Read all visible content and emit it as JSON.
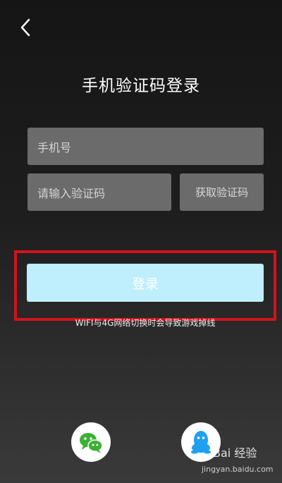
{
  "header": {
    "back_icon": "chevron-left-icon",
    "title": "手机验证码登录"
  },
  "form": {
    "phone_placeholder": "手机号",
    "code_placeholder": "请输入验证码",
    "get_code_label": "获取验证码",
    "login_label": "登录",
    "notice": "WIFI与4G网络切换时会导致游戏掉线"
  },
  "social": {
    "wechat_icon": "wechat-icon",
    "qq_icon": "qq-icon"
  },
  "watermark": {
    "logo": "Bai 经验",
    "url": "jingyan.baidu.com"
  },
  "colors": {
    "login_button": "#bfeefc",
    "highlight_box": "#d4121b",
    "input_background": "#6b6b6b"
  }
}
